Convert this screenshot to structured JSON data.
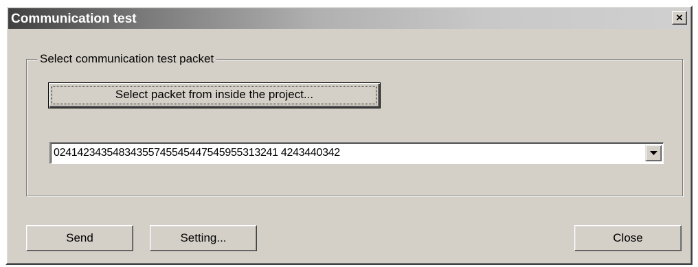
{
  "window": {
    "title": "Communication test",
    "close_glyph": "×",
    "close_icon": "close-icon"
  },
  "group": {
    "legend": "Select communication test packet",
    "select_packet_button": "Select packet from inside the project...",
    "packet_value": "02414234354834355745545447545955313241 4243440342",
    "dropdown_icon": "chevron-down-icon"
  },
  "footer": {
    "send_label": "Send",
    "setting_label": "Setting...",
    "close_label": "Close"
  }
}
